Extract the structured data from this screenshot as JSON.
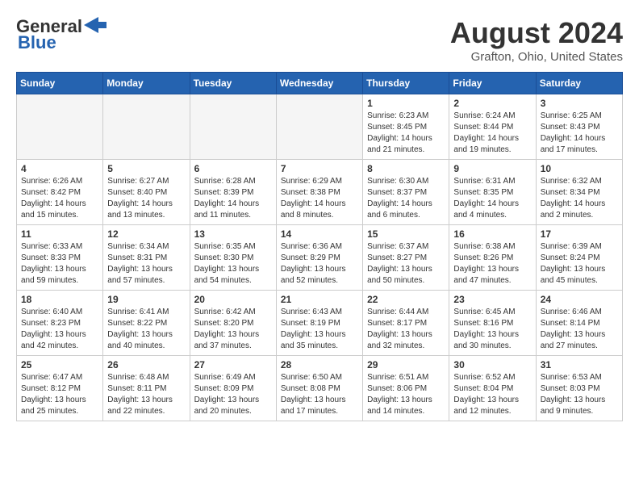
{
  "header": {
    "logo_general": "General",
    "logo_blue": "Blue",
    "month_year": "August 2024",
    "location": "Grafton, Ohio, United States"
  },
  "weekdays": [
    "Sunday",
    "Monday",
    "Tuesday",
    "Wednesday",
    "Thursday",
    "Friday",
    "Saturday"
  ],
  "weeks": [
    [
      {
        "day": "",
        "text": "",
        "empty": true
      },
      {
        "day": "",
        "text": "",
        "empty": true
      },
      {
        "day": "",
        "text": "",
        "empty": true
      },
      {
        "day": "",
        "text": "",
        "empty": true
      },
      {
        "day": "1",
        "text": "Sunrise: 6:23 AM\nSunset: 8:45 PM\nDaylight: 14 hours\nand 21 minutes."
      },
      {
        "day": "2",
        "text": "Sunrise: 6:24 AM\nSunset: 8:44 PM\nDaylight: 14 hours\nand 19 minutes."
      },
      {
        "day": "3",
        "text": "Sunrise: 6:25 AM\nSunset: 8:43 PM\nDaylight: 14 hours\nand 17 minutes."
      }
    ],
    [
      {
        "day": "4",
        "text": "Sunrise: 6:26 AM\nSunset: 8:42 PM\nDaylight: 14 hours\nand 15 minutes."
      },
      {
        "day": "5",
        "text": "Sunrise: 6:27 AM\nSunset: 8:40 PM\nDaylight: 14 hours\nand 13 minutes."
      },
      {
        "day": "6",
        "text": "Sunrise: 6:28 AM\nSunset: 8:39 PM\nDaylight: 14 hours\nand 11 minutes."
      },
      {
        "day": "7",
        "text": "Sunrise: 6:29 AM\nSunset: 8:38 PM\nDaylight: 14 hours\nand 8 minutes."
      },
      {
        "day": "8",
        "text": "Sunrise: 6:30 AM\nSunset: 8:37 PM\nDaylight: 14 hours\nand 6 minutes."
      },
      {
        "day": "9",
        "text": "Sunrise: 6:31 AM\nSunset: 8:35 PM\nDaylight: 14 hours\nand 4 minutes."
      },
      {
        "day": "10",
        "text": "Sunrise: 6:32 AM\nSunset: 8:34 PM\nDaylight: 14 hours\nand 2 minutes."
      }
    ],
    [
      {
        "day": "11",
        "text": "Sunrise: 6:33 AM\nSunset: 8:33 PM\nDaylight: 13 hours\nand 59 minutes."
      },
      {
        "day": "12",
        "text": "Sunrise: 6:34 AM\nSunset: 8:31 PM\nDaylight: 13 hours\nand 57 minutes."
      },
      {
        "day": "13",
        "text": "Sunrise: 6:35 AM\nSunset: 8:30 PM\nDaylight: 13 hours\nand 54 minutes."
      },
      {
        "day": "14",
        "text": "Sunrise: 6:36 AM\nSunset: 8:29 PM\nDaylight: 13 hours\nand 52 minutes."
      },
      {
        "day": "15",
        "text": "Sunrise: 6:37 AM\nSunset: 8:27 PM\nDaylight: 13 hours\nand 50 minutes."
      },
      {
        "day": "16",
        "text": "Sunrise: 6:38 AM\nSunset: 8:26 PM\nDaylight: 13 hours\nand 47 minutes."
      },
      {
        "day": "17",
        "text": "Sunrise: 6:39 AM\nSunset: 8:24 PM\nDaylight: 13 hours\nand 45 minutes."
      }
    ],
    [
      {
        "day": "18",
        "text": "Sunrise: 6:40 AM\nSunset: 8:23 PM\nDaylight: 13 hours\nand 42 minutes."
      },
      {
        "day": "19",
        "text": "Sunrise: 6:41 AM\nSunset: 8:22 PM\nDaylight: 13 hours\nand 40 minutes."
      },
      {
        "day": "20",
        "text": "Sunrise: 6:42 AM\nSunset: 8:20 PM\nDaylight: 13 hours\nand 37 minutes."
      },
      {
        "day": "21",
        "text": "Sunrise: 6:43 AM\nSunset: 8:19 PM\nDaylight: 13 hours\nand 35 minutes."
      },
      {
        "day": "22",
        "text": "Sunrise: 6:44 AM\nSunset: 8:17 PM\nDaylight: 13 hours\nand 32 minutes."
      },
      {
        "day": "23",
        "text": "Sunrise: 6:45 AM\nSunset: 8:16 PM\nDaylight: 13 hours\nand 30 minutes."
      },
      {
        "day": "24",
        "text": "Sunrise: 6:46 AM\nSunset: 8:14 PM\nDaylight: 13 hours\nand 27 minutes."
      }
    ],
    [
      {
        "day": "25",
        "text": "Sunrise: 6:47 AM\nSunset: 8:12 PM\nDaylight: 13 hours\nand 25 minutes."
      },
      {
        "day": "26",
        "text": "Sunrise: 6:48 AM\nSunset: 8:11 PM\nDaylight: 13 hours\nand 22 minutes."
      },
      {
        "day": "27",
        "text": "Sunrise: 6:49 AM\nSunset: 8:09 PM\nDaylight: 13 hours\nand 20 minutes."
      },
      {
        "day": "28",
        "text": "Sunrise: 6:50 AM\nSunset: 8:08 PM\nDaylight: 13 hours\nand 17 minutes."
      },
      {
        "day": "29",
        "text": "Sunrise: 6:51 AM\nSunset: 8:06 PM\nDaylight: 13 hours\nand 14 minutes."
      },
      {
        "day": "30",
        "text": "Sunrise: 6:52 AM\nSunset: 8:04 PM\nDaylight: 13 hours\nand 12 minutes."
      },
      {
        "day": "31",
        "text": "Sunrise: 6:53 AM\nSunset: 8:03 PM\nDaylight: 13 hours\nand 9 minutes."
      }
    ]
  ]
}
